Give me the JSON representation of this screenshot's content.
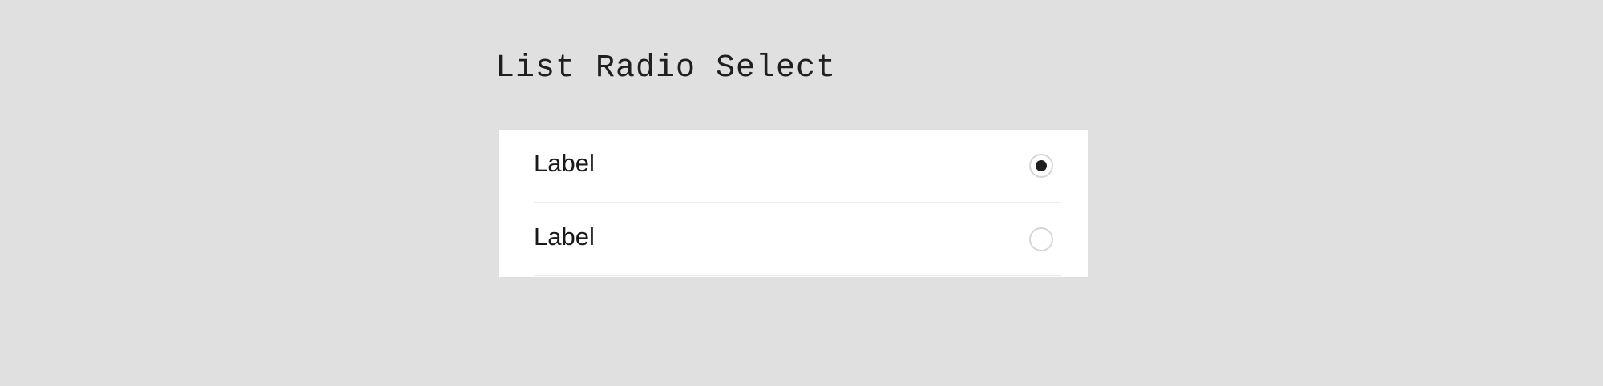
{
  "title": "List Radio Select",
  "options": [
    {
      "label": "Label",
      "selected": true
    },
    {
      "label": "Label",
      "selected": false
    }
  ],
  "colors": {
    "background": "#e0e0e0",
    "card": "#ffffff",
    "text": "#1a1a1a",
    "radio_border": "#d6d6d6",
    "radio_fill": "#1e1e1e",
    "divider": "#ececec"
  }
}
